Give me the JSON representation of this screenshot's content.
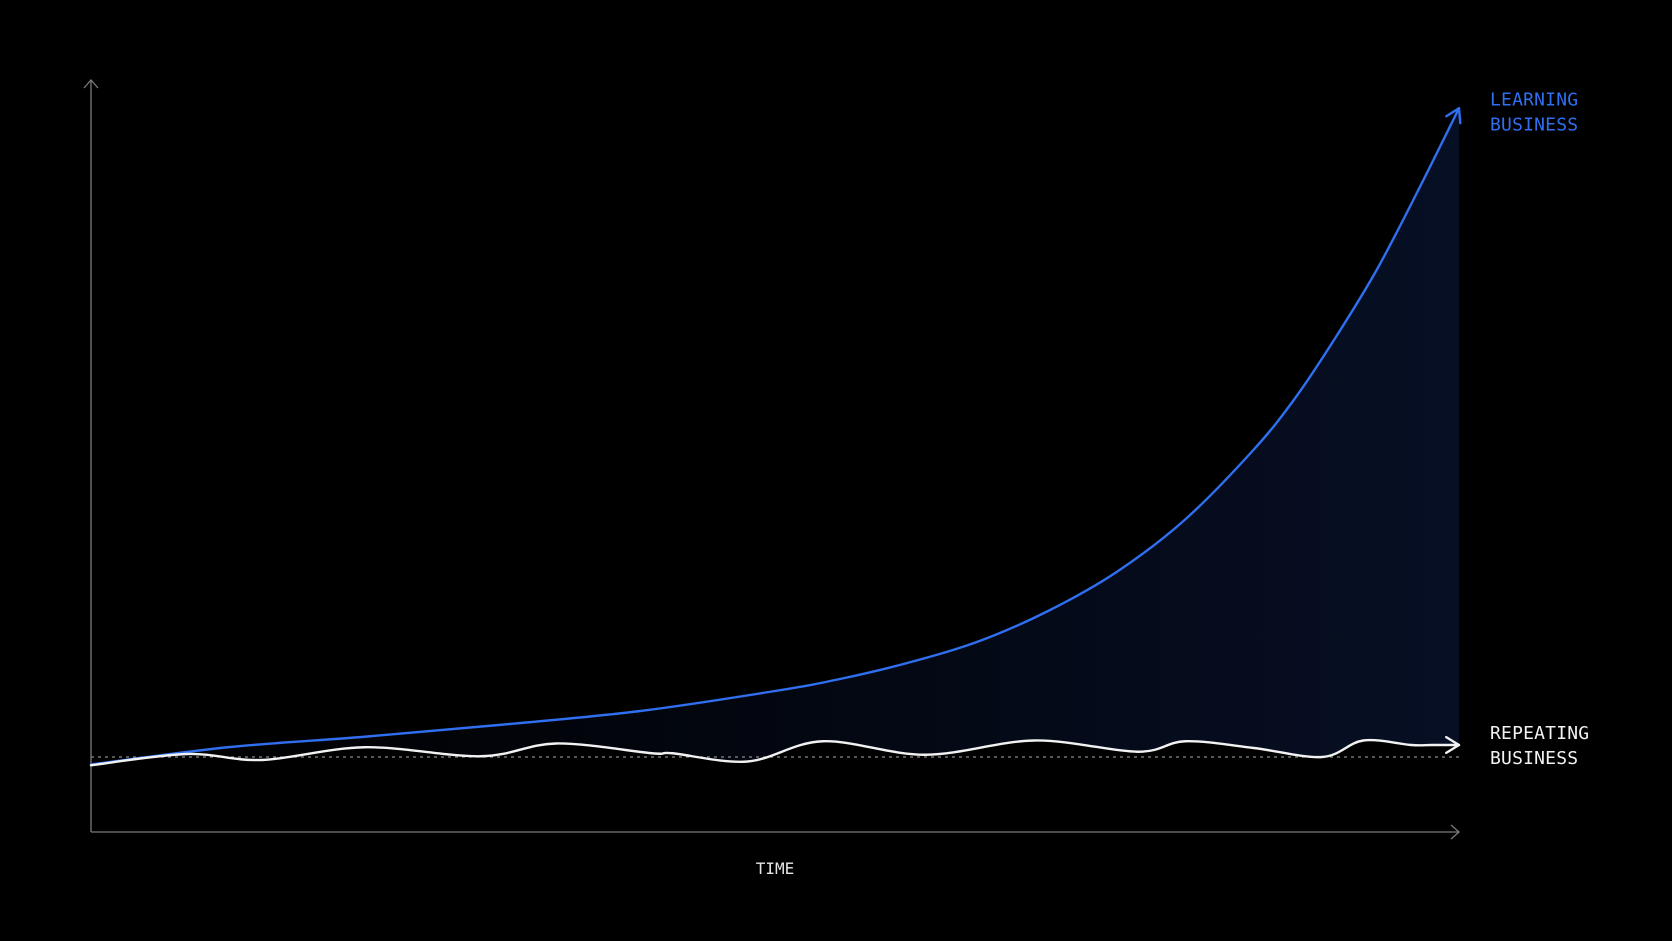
{
  "chart_data": {
    "type": "line",
    "title": "",
    "xlabel": "TIME",
    "ylabel": "",
    "grid": false,
    "legend": "none",
    "colors": {
      "background": "#000000",
      "axis": "#7a7a7a",
      "baseline": "#8a8a8a",
      "learning": "#2f6ff0",
      "repeating": "#f2f2f2",
      "fill": "#1a3a8c"
    },
    "xlim": [
      0,
      100
    ],
    "ylim": [
      -10,
      90
    ],
    "baseline_value": 0,
    "series": [
      {
        "name_lines": [
          "LEARNING",
          "BUSINESS"
        ],
        "color": "#2f6ff0",
        "curve": "smooth",
        "end_arrow": true,
        "x": [
          0,
          10,
          20,
          30,
          40,
          50,
          55,
          60,
          65,
          70,
          75,
          80,
          85,
          88,
          91,
          94,
          97,
          100
        ],
        "y": [
          -1,
          1.3,
          2.7,
          4.3,
          6.1,
          8.8,
          10.5,
          12.7,
          15.5,
          19.5,
          24.7,
          31.7,
          41,
          47.8,
          56,
          65,
          75.5,
          86.5
        ]
      },
      {
        "name_lines": [
          "REPEATING",
          "BUSINESS"
        ],
        "color": "#f2f2f2",
        "curve": "smooth",
        "end_arrow": true,
        "x": [
          0,
          7,
          12.5,
          20,
          28.5,
          34,
          41,
          42.5,
          48,
          53.5,
          61,
          69,
          76.5,
          80,
          85,
          90,
          93,
          96.5,
          98,
          100
        ],
        "y": [
          -1.1,
          0.4,
          -0.4,
          1.3,
          0.1,
          1.8,
          0.5,
          0.5,
          -0.6,
          2.1,
          0.3,
          2.2,
          0.7,
          2.1,
          1.2,
          0,
          2.2,
          1.6,
          1.6,
          1.6
        ]
      }
    ]
  }
}
